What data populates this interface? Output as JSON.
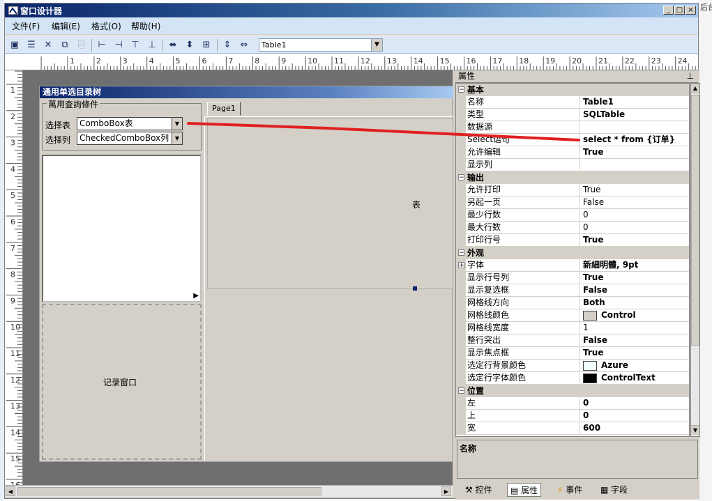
{
  "window": {
    "title": "窗口设计器",
    "buttons": [
      "_",
      "□",
      "×"
    ]
  },
  "desktop": {
    "edge_text": "后台"
  },
  "menu": [
    {
      "label": "文件(F)"
    },
    {
      "label": "编辑(E)"
    },
    {
      "label": "格式(O)"
    },
    {
      "label": "帮助(H)"
    }
  ],
  "toolbar": {
    "icons": [
      "save-icon",
      "save-all-icon",
      "delete-icon",
      "copy-icon",
      "paste-icon",
      "align-left-icon",
      "align-right-icon",
      "align-top-icon",
      "align-bottom-icon",
      "same-width-icon",
      "same-height-icon",
      "same-size-icon",
      "center-vertical-icon",
      "center-horizontal-icon"
    ],
    "component_select": "Table1"
  },
  "ruler": {
    "h_labels": [
      "1",
      "2",
      "3",
      "4",
      "5",
      "6",
      "7",
      "8",
      "9",
      "10",
      "11",
      "12",
      "13",
      "14",
      "15",
      "16",
      "17",
      "18",
      "19",
      "20",
      "21",
      "22",
      "23",
      "24"
    ],
    "v_labels": [
      "1",
      "2",
      "3",
      "4",
      "5",
      "6",
      "7",
      "8",
      "9",
      "10",
      "11",
      "12",
      "13",
      "14",
      "15",
      "16"
    ]
  },
  "form": {
    "title": "通用单选目录树",
    "group_title": "萬用查詢條件",
    "select_table_label": "选择表",
    "select_table_value": "ComboBox表",
    "select_column_label": "选择列",
    "select_column_value": "CheckedComboBox列",
    "record_window_label": "记录窗口",
    "tab_label": "Page1",
    "table_label": "表"
  },
  "properties": {
    "header": "属性",
    "pin_icon": "pin-icon",
    "categories": [
      {
        "name": "基本",
        "rows": [
          {
            "name": "名称",
            "value": "Table1",
            "bold": true
          },
          {
            "name": "类型",
            "value": "SQLTable",
            "bold": true
          },
          {
            "name": "数据源",
            "value": "",
            "bold": false
          },
          {
            "name": "Select语句",
            "value": "select * from {订单}",
            "bold": true
          },
          {
            "name": "允许编辑",
            "value": "True",
            "bold": true
          },
          {
            "name": "显示列",
            "value": "",
            "bold": false
          }
        ]
      },
      {
        "name": "输出",
        "rows": [
          {
            "name": "允许打印",
            "value": "True",
            "bold": false
          },
          {
            "name": "另起一页",
            "value": "False",
            "bold": false
          },
          {
            "name": "最少行数",
            "value": "0",
            "bold": false
          },
          {
            "name": "最大行数",
            "value": "0",
            "bold": false
          },
          {
            "name": "打印行号",
            "value": "True",
            "bold": true
          }
        ]
      },
      {
        "name": "外观",
        "rows": [
          {
            "name": "字体",
            "value": "新細明體, 9pt",
            "bold": true,
            "expandable": true
          },
          {
            "name": "显示行号列",
            "value": "True",
            "bold": true
          },
          {
            "name": "显示复选框",
            "value": "False",
            "bold": true
          },
          {
            "name": "网格线方向",
            "value": "Both",
            "bold": true
          },
          {
            "name": "网格线颜色",
            "value": "Control",
            "bold": true,
            "swatch": "#d4d0c8"
          },
          {
            "name": "网格线宽度",
            "value": "1",
            "bold": false
          },
          {
            "name": "整行突出",
            "value": "False",
            "bold": true
          },
          {
            "name": "显示焦点框",
            "value": "True",
            "bold": true
          },
          {
            "name": "选定行背景颜色",
            "value": "Azure",
            "bold": true,
            "swatch": "#f0ffff"
          },
          {
            "name": "选定行字体颜色",
            "value": "ControlText",
            "bold": true,
            "swatch": "#000000"
          }
        ]
      },
      {
        "name": "位置",
        "rows": [
          {
            "name": "左",
            "value": "0",
            "bold": true
          },
          {
            "name": "上",
            "value": "0",
            "bold": true
          },
          {
            "name": "宽",
            "value": "600",
            "bold": true
          }
        ]
      }
    ],
    "description_title": "名称",
    "tabs": [
      {
        "label": "控件",
        "icon": "controls-icon"
      },
      {
        "label": "属性",
        "icon": "properties-icon",
        "active": true
      },
      {
        "label": "事件",
        "icon": "events-icon"
      },
      {
        "label": "字段",
        "icon": "fields-icon"
      }
    ]
  },
  "colors": {
    "annotation_line": "#e02020",
    "title_gradient_start": "#0a246a",
    "menu_bg": "#d4e4f7"
  }
}
